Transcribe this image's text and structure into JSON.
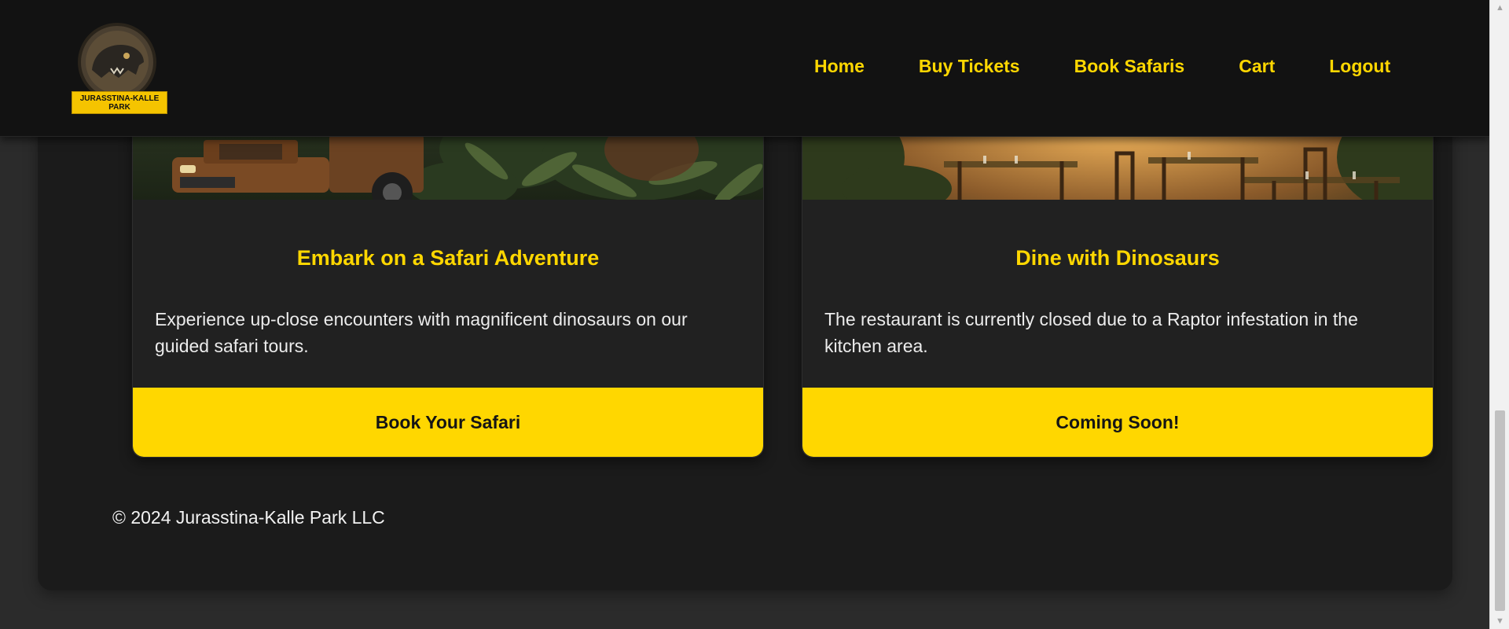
{
  "logo": {
    "line1": "JURASSTINA-KALLE",
    "line2": "PARK"
  },
  "nav": {
    "links": [
      {
        "label": "Home"
      },
      {
        "label": "Buy Tickets"
      },
      {
        "label": "Book Safaris"
      },
      {
        "label": "Cart"
      },
      {
        "label": "Logout"
      }
    ]
  },
  "cards": [
    {
      "title": "Embark on a Safari Adventure",
      "text": "Experience up-close encounters with magnificent dinosaurs on our guided safari tours.",
      "button": "Book Your Safari"
    },
    {
      "title": "Dine with Dinosaurs",
      "text": "The restaurant is currently closed due to a Raptor infestation in the kitchen area.",
      "button": "Coming Soon!"
    }
  ],
  "footer": {
    "text": "© 2024 Jurasstina-Kalle Park LLC"
  },
  "colors": {
    "accent": "#ffd700",
    "navbar": "#121212",
    "container": "#1b1b1b",
    "card": "#212121",
    "page": "#2b2b2b"
  },
  "icons": {
    "logo": "t-rex-skull-logo",
    "scroll_up": "scroll-up-arrow-icon",
    "scroll_down": "scroll-down-arrow-icon"
  }
}
